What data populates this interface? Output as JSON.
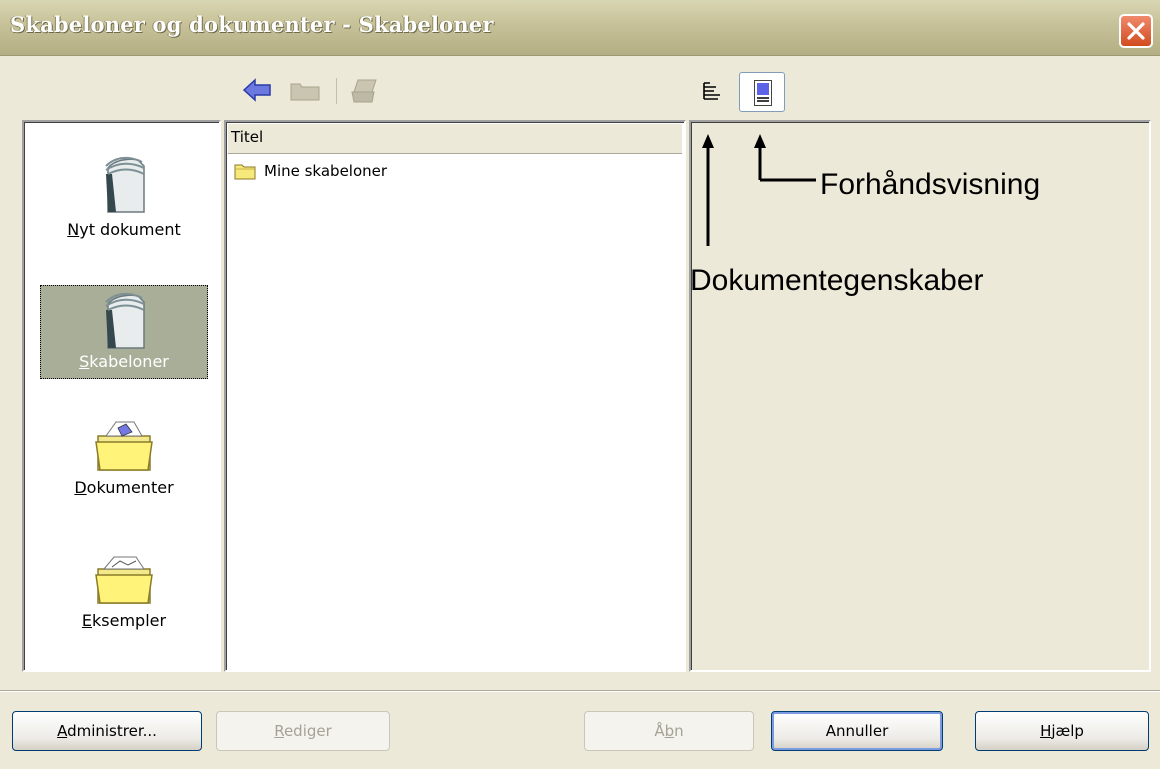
{
  "window": {
    "title": "Skabeloner og dokumenter - Skabeloner"
  },
  "categories": [
    {
      "label": "Nyt dokument",
      "mnemonic": "N",
      "rest": "yt dokument",
      "selected": false
    },
    {
      "label": "Skabeloner",
      "mnemonic": "S",
      "rest": "kabeloner",
      "selected": true
    },
    {
      "label": "Dokumenter",
      "mnemonic": "D",
      "rest": "okumenter",
      "selected": false
    },
    {
      "label": "Eksempler",
      "mnemonic": "E",
      "rest": "ksempler",
      "selected": false
    }
  ],
  "list": {
    "column_header": "Titel",
    "items": [
      {
        "label": "Mine skabeloner"
      }
    ]
  },
  "annotations": {
    "preview": "Forhåndsvisning",
    "properties": "Dokumentegenskaber"
  },
  "buttons": {
    "manage": {
      "mnemonic": "A",
      "rest": "dministrer..."
    },
    "edit": {
      "mnemonic": "R",
      "rest": "ediger"
    },
    "open": {
      "pre": "Å",
      "mnemonic": "b",
      "rest": "n"
    },
    "cancel": {
      "label": "Annuller"
    },
    "help": {
      "mnemonic": "H",
      "rest": "jælp"
    }
  },
  "colors": {
    "window_bg": "#ece9d8",
    "titlebar": "#c8c39a",
    "selection": "#a9ae98",
    "close_button": "#d24c1f"
  }
}
